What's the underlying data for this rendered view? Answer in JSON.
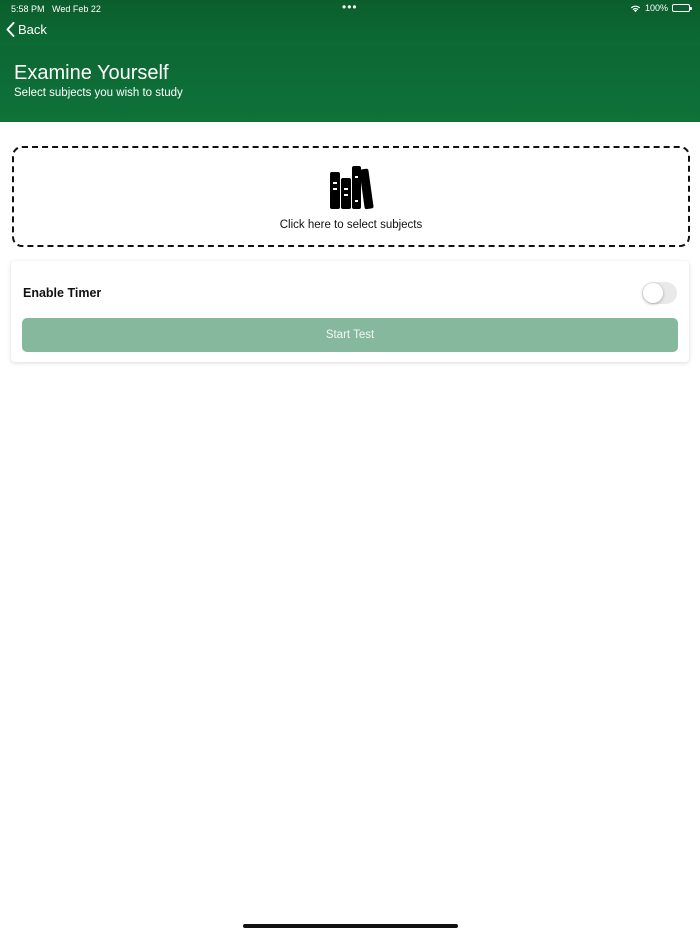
{
  "status_bar": {
    "time": "5:58 PM",
    "date": "Wed Feb 22",
    "dots": "•••",
    "battery": "100%"
  },
  "nav": {
    "back_label": "Back"
  },
  "header": {
    "title": "Examine Yourself",
    "subtitle": "Select subjects you wish to study"
  },
  "subject_picker": {
    "label": "Click here to select subjects",
    "icon": "books-icon"
  },
  "options": {
    "timer_label": "Enable Timer",
    "timer_enabled": false,
    "start_label": "Start Test"
  },
  "colors": {
    "header_green": "#0e6b35",
    "button_green_disabled": "#86b89d"
  }
}
